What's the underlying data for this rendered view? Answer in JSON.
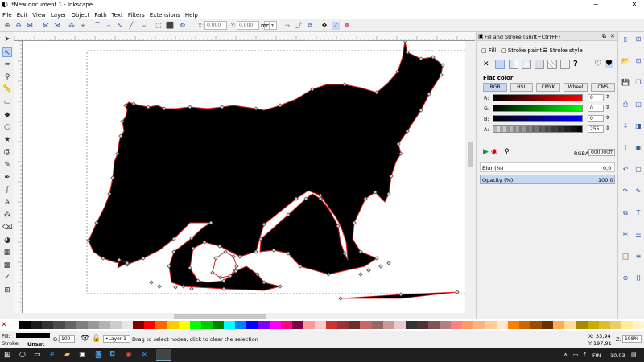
{
  "window": {
    "title": "*New document 1 - Inkscape",
    "controls": [
      "−",
      "☐",
      "✕"
    ]
  },
  "menu": [
    "File",
    "Edit",
    "View",
    "Layer",
    "Object",
    "Path",
    "Text",
    "Filters",
    "Extensions",
    "Help"
  ],
  "toolbar": {
    "x_label": "X:",
    "x_value": "0,000",
    "y_label": "Y:",
    "y_value": "0,000",
    "unit": "mm"
  },
  "tools": [
    {
      "name": "selector-tool-icon",
      "glyph": "➤"
    },
    {
      "name": "node-tool-icon",
      "glyph": "↖",
      "active": true
    },
    {
      "name": "tweak-tool-icon",
      "glyph": "≈"
    },
    {
      "name": "zoom-tool-icon",
      "glyph": "⚲"
    },
    {
      "name": "measure-tool-icon",
      "glyph": "📏"
    },
    {
      "name": "rectangle-tool-icon",
      "glyph": "▭"
    },
    {
      "name": "3dbox-tool-icon",
      "glyph": "◆"
    },
    {
      "name": "ellipse-tool-icon",
      "glyph": "○"
    },
    {
      "name": "star-tool-icon",
      "glyph": "★"
    },
    {
      "name": "spiral-tool-icon",
      "glyph": "@"
    },
    {
      "name": "pencil-tool-icon",
      "glyph": "✎"
    },
    {
      "name": "pen-tool-icon",
      "glyph": "✒"
    },
    {
      "name": "calligraphy-tool-icon",
      "glyph": "∫"
    },
    {
      "name": "text-tool-icon",
      "glyph": "A"
    },
    {
      "name": "spray-tool-icon",
      "glyph": "⁂"
    },
    {
      "name": "eraser-tool-icon",
      "glyph": "⌫"
    },
    {
      "name": "bucket-tool-icon",
      "glyph": "◕"
    },
    {
      "name": "gradient-tool-icon",
      "glyph": "▦"
    },
    {
      "name": "mesh-tool-icon",
      "glyph": "▩"
    },
    {
      "name": "dropper-tool-icon",
      "glyph": "✓"
    },
    {
      "name": "connector-tool-icon",
      "glyph": "⊞"
    }
  ],
  "panel": {
    "title": "Fill and Stroke (Shift+Ctrl+F)",
    "tabs": [
      "Fill",
      "Stroke paint",
      "Stroke style"
    ],
    "flat_color_label": "Flat color",
    "color_modes": [
      "RGB",
      "HSL",
      "CMYK",
      "Wheel",
      "CMS"
    ],
    "channels": [
      {
        "label": "R:",
        "value": "0",
        "color": "#ff0000"
      },
      {
        "label": "G:",
        "value": "0",
        "color": "#00ff00"
      },
      {
        "label": "B:",
        "value": "0",
        "color": "#0000ff"
      },
      {
        "label": "A:",
        "value": "255",
        "color": "#000000"
      }
    ],
    "rgba_label": "RGBA:",
    "rgba_value": "000000ff",
    "blur_label": "Blur (%)",
    "blur_value": "0,0",
    "opacity_label": "Opacity (%)",
    "opacity_value": "100,0"
  },
  "status": {
    "fill_label": "Fill:",
    "stroke_label": "Stroke:",
    "stroke_value": "Unset",
    "opacity_label": "O:",
    "opacity_value": "100",
    "layer_value": "•Layer 1",
    "message": "Drag to select nodes, click to clear the selection",
    "x_label": "X:",
    "x_value": "33,94",
    "y_label": "Y:",
    "y_value": "197,91",
    "z_label": "Z:",
    "zoom_value": "198%"
  },
  "taskbar": {
    "lang": "FIN",
    "time": "10.03"
  },
  "palette": [
    "#ffffff",
    "#000000",
    "#1a1a1a",
    "#333333",
    "#4d4d4d",
    "#666666",
    "#808080",
    "#999999",
    "#b3b3b3",
    "#cccccc",
    "#e6e6e6",
    "#800000",
    "#ff0000",
    "#ff6600",
    "#ffcc00",
    "#ffff00",
    "#00ff00",
    "#00cc00",
    "#008000",
    "#00ffff",
    "#0080ff",
    "#0000ff",
    "#8000ff",
    "#ff00ff",
    "#ff0080",
    "#800040",
    "#ff9999",
    "#ffcccc",
    "#cc3333",
    "#993333",
    "#663333",
    "#cc6666",
    "#996666",
    "#cc9999",
    "#e6cccc",
    "#333333",
    "#4d3333",
    "#805555",
    "#b38080",
    "#ff8080",
    "#ff9966",
    "#ffb380",
    "#ffcc99",
    "#ffe6cc",
    "#ff8000",
    "#cc6600",
    "#994d00",
    "#663300",
    "#ffaa55",
    "#ffdd99",
    "#aa8800",
    "#ccaa00",
    "#ddbb33",
    "#eecc66",
    "#ffee99",
    "#fff5cc"
  ]
}
